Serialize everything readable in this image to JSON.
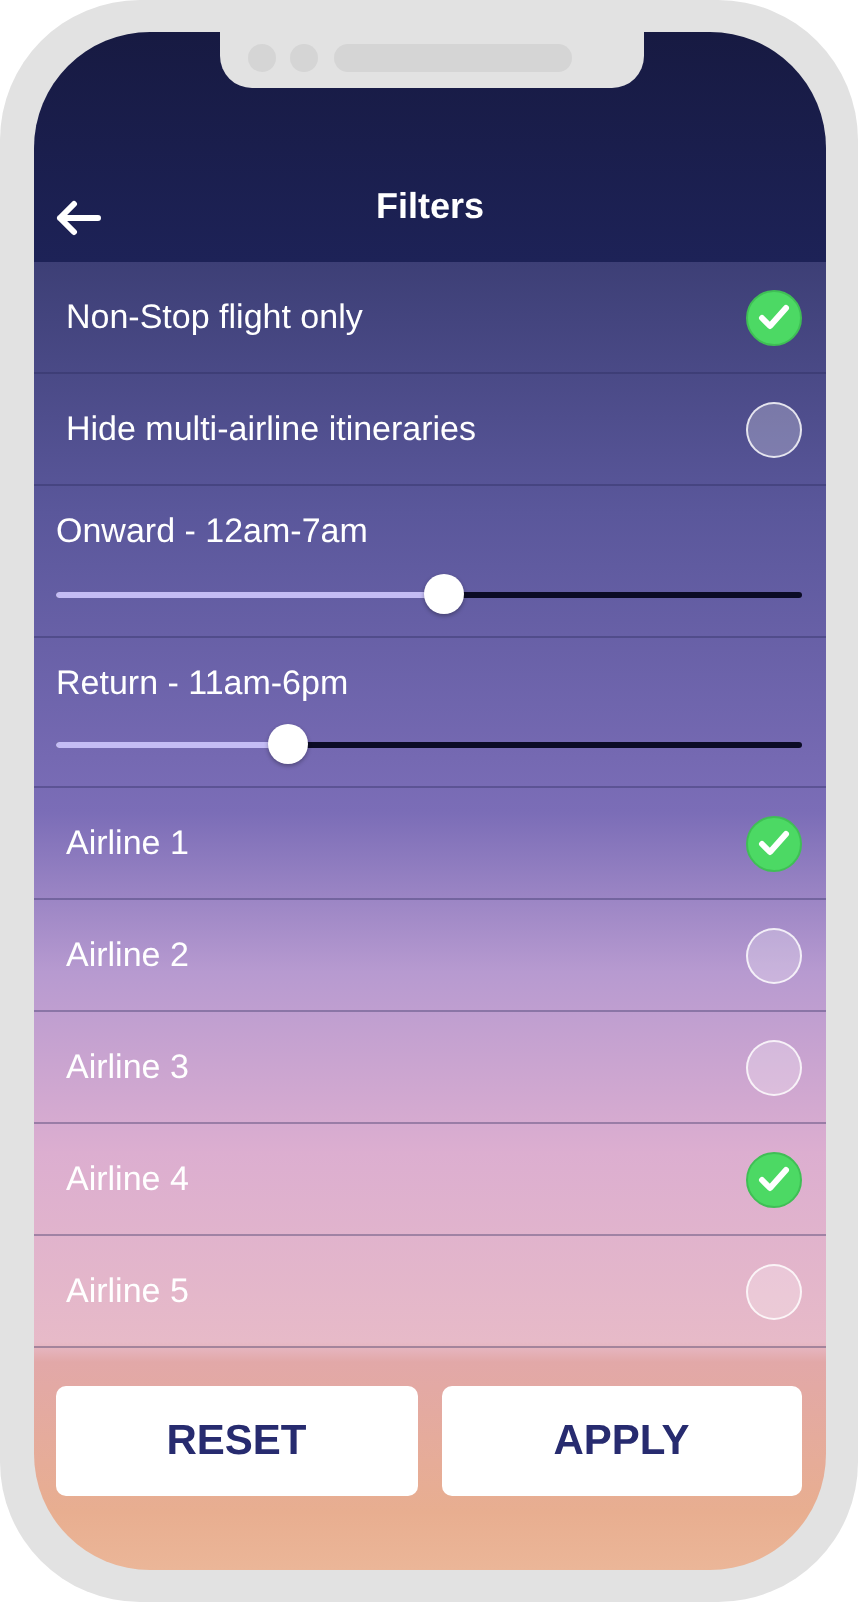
{
  "header": {
    "title": "Filters"
  },
  "options": [
    {
      "kind": "check",
      "label": "Non-Stop flight only",
      "checked": true
    },
    {
      "kind": "check",
      "label": "Hide multi-airline itineraries",
      "checked": false
    },
    {
      "kind": "slider",
      "label": "Onward - 12am-7am",
      "level": 0.52
    },
    {
      "kind": "slider",
      "label": "Return - 11am-6pm",
      "level": 0.31
    },
    {
      "kind": "check",
      "label": "Airline 1",
      "checked": true
    },
    {
      "kind": "check",
      "label": "Airline 2",
      "checked": false
    },
    {
      "kind": "check",
      "label": "Airline 3",
      "checked": false
    },
    {
      "kind": "check",
      "label": "Airline 4",
      "checked": true
    },
    {
      "kind": "check",
      "label": "Airline 5",
      "checked": false
    }
  ],
  "buttons": [
    "RESET",
    "APPLY"
  ]
}
